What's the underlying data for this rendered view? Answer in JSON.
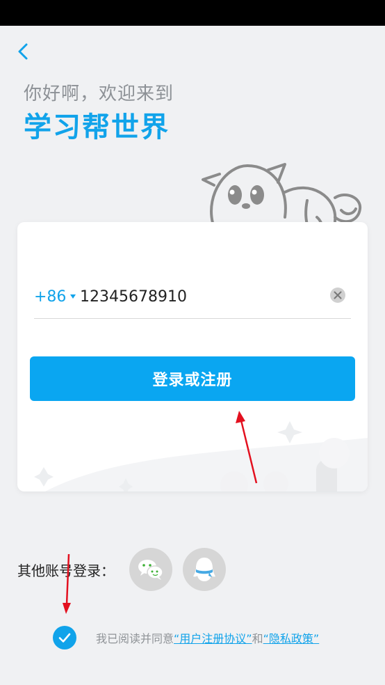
{
  "header": {
    "greeting": "你好啊，欢迎来到",
    "headline": "学习帮世界"
  },
  "login_card": {
    "country_code": "+86",
    "phone_value": "12345678910",
    "submit_label": "登录或注册"
  },
  "other_login": {
    "label": "其他账号登录：",
    "providers": [
      {
        "name": "wechat-icon"
      },
      {
        "name": "qq-icon"
      }
    ]
  },
  "agreement": {
    "checked": true,
    "prefix": "我已阅读并同意",
    "user_agreement": "“用户注册协议”",
    "conjunction": "和",
    "privacy_policy": "“隐私政策”"
  },
  "colors": {
    "accent": "#11a3ea",
    "button": "#0aa6f1",
    "annotation": "#e3101f"
  }
}
